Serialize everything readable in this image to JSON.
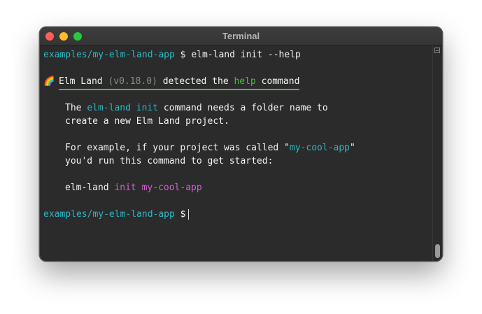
{
  "window": {
    "title": "Terminal",
    "traffic_lights": {
      "close_color": "#fe5f57",
      "minimize_color": "#febc2e",
      "maximize_color": "#28c840"
    }
  },
  "colors": {
    "background": "#2b2b2b",
    "text": "#f2f2f2",
    "path": "#2bb8c4",
    "green": "#3ec33c",
    "cyan": "#2bb8c4",
    "magenta": "#d45fd4",
    "dim": "#8a8a8a",
    "underline": "#3ec33c"
  },
  "terminal": {
    "prompt1": {
      "path": "examples/my-elm-land-app",
      "symbol": " $ ",
      "command": "elm-land init --help"
    },
    "headline": {
      "emoji_icon": "rainbow-icon",
      "emoji": "🌈",
      "part1": "Elm Land ",
      "version": "(v0.18.0)",
      "part2": " detected the ",
      "keyword": "help",
      "part3": " command"
    },
    "paragraph1": {
      "line1_prefix": "The ",
      "line1_cmd1": "elm-land",
      "line1_space": " ",
      "line1_cmd2": "init",
      "line1_suffix": " command needs a folder name to",
      "line2": "create a new Elm Land project."
    },
    "paragraph2": {
      "line1_prefix": "For example, if your project was called \"",
      "line1_name": "my-cool-app",
      "line1_suffix": "\"",
      "line2": "you'd run this command to get started:"
    },
    "example": {
      "cmd": "elm-land ",
      "sub": "init",
      "space": " ",
      "arg": "my-cool-app"
    },
    "prompt2": {
      "path": "examples/my-elm-land-app",
      "symbol": " $"
    }
  }
}
